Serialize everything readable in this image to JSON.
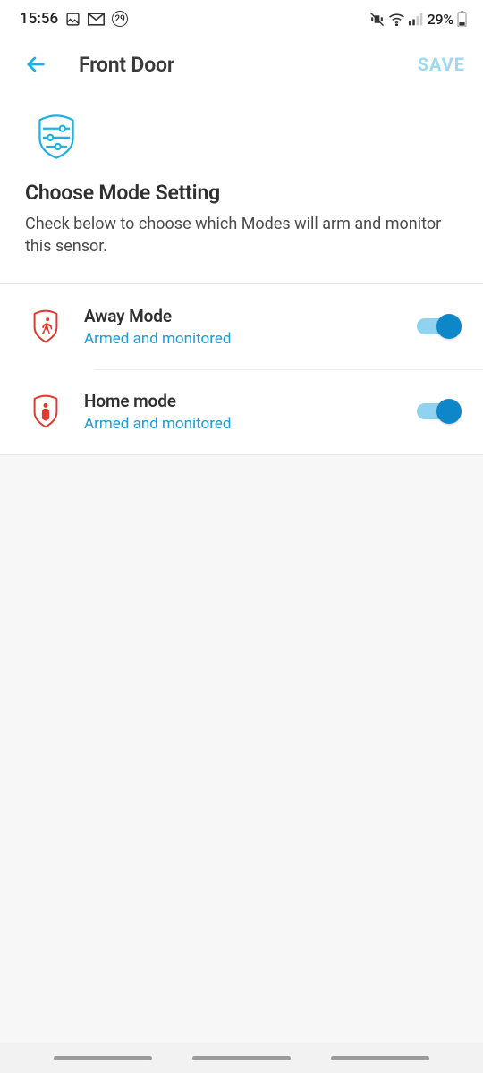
{
  "status": {
    "time": "15:56",
    "badge_count": "29",
    "battery_pct": "29%"
  },
  "header": {
    "title": "Front Door",
    "save_label": "SAVE"
  },
  "intro": {
    "title": "Choose Mode Setting",
    "description": "Check below to choose which Modes will arm and monitor this sensor."
  },
  "modes": [
    {
      "title": "Away Mode",
      "subtitle": "Armed and monitored",
      "enabled": true
    },
    {
      "title": "Home mode",
      "subtitle": "Armed and monitored",
      "enabled": true
    }
  ]
}
